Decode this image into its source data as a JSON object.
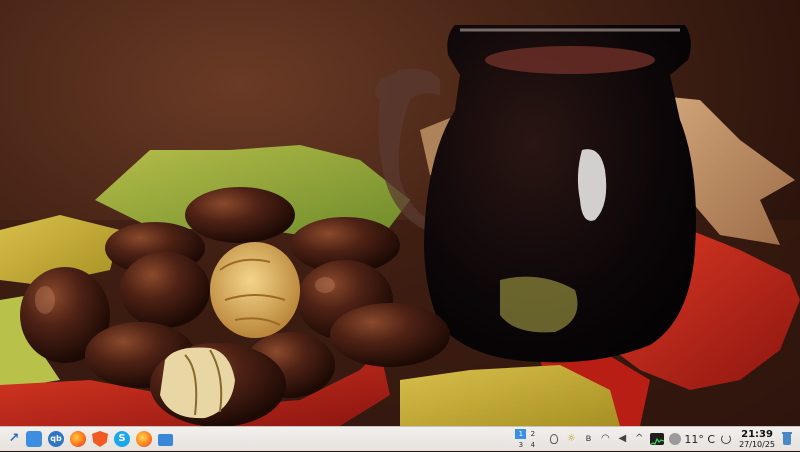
{
  "wallpaper": {
    "description_name": "chestnuts-and-jug-wallpaper"
  },
  "panel": {
    "launchers": [
      {
        "name": "application-menu-icon",
        "glyph": "↗"
      },
      {
        "name": "file-manager-icon",
        "glyph": ""
      },
      {
        "name": "qbittorrent-icon",
        "glyph": "qb"
      },
      {
        "name": "firefox-icon",
        "glyph": ""
      },
      {
        "name": "brave-browser-icon",
        "glyph": ""
      },
      {
        "name": "skype-icon",
        "glyph": "S"
      },
      {
        "name": "firefox-alt-icon",
        "glyph": ""
      },
      {
        "name": "folder-icon",
        "glyph": ""
      }
    ],
    "pager": [
      "1",
      "2",
      "3",
      "4"
    ],
    "pager_active": "1",
    "tray": {
      "chevron": "^",
      "volume": "◀",
      "bluetooth": "ʙ",
      "wifi": "◠",
      "sun": "☼"
    },
    "weather": "11° C",
    "clock": {
      "time": "21:39",
      "date": "27/10/25"
    }
  },
  "colors": {
    "panel_bg": "#ece8e4",
    "accent": "#3b8fe3"
  }
}
